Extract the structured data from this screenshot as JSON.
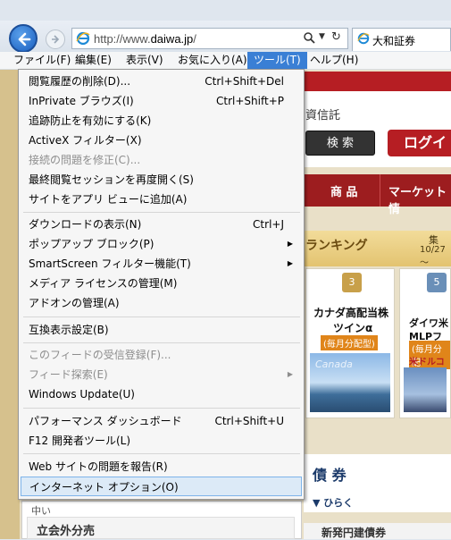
{
  "browser": {
    "address": {
      "prefix": "http://www.",
      "domain": "daiwa.jp",
      "suffix": "/"
    },
    "tab_title": "大和証券"
  },
  "menubar": [
    {
      "label": "ファイル(F)"
    },
    {
      "label": "編集(E)"
    },
    {
      "label": "表示(V)"
    },
    {
      "label": "お気に入り(A)"
    },
    {
      "label": "ツール(T)",
      "active": true
    },
    {
      "label": "ヘルプ(H)"
    }
  ],
  "tools_menu": [
    {
      "label": "閲覧履歴の削除(D)...",
      "shortcut": "Ctrl+Shift+Del"
    },
    {
      "label": "InPrivate ブラウズ(I)",
      "shortcut": "Ctrl+Shift+P"
    },
    {
      "label": "追跡防止を有効にする(K)"
    },
    {
      "label": "ActiveX フィルター(X)"
    },
    {
      "label": "接続の問題を修正(C)...",
      "disabled": true
    },
    {
      "label": "最終閲覧セッションを再度開く(S)"
    },
    {
      "label": "サイトをアプリ ビューに追加(A)"
    },
    {
      "label": "ダウンロードの表示(N)",
      "shortcut": "Ctrl+J"
    },
    {
      "label": "ポップアップ ブロック(P)",
      "submenu": true
    },
    {
      "label": "SmartScreen フィルター機能(T)",
      "submenu": true
    },
    {
      "label": "メディア ライセンスの管理(M)"
    },
    {
      "label": "アドオンの管理(A)"
    },
    {
      "label": "互換表示設定(B)"
    },
    {
      "label": "このフィードの受信登録(F)...",
      "disabled": true
    },
    {
      "label": "フィード探索(E)",
      "disabled": true,
      "submenu": true
    },
    {
      "label": "Windows Update(U)"
    },
    {
      "label": "パフォーマンス ダッシュボード",
      "shortcut": "Ctrl+Shift+U"
    },
    {
      "label": "F12 開発者ツール(L)"
    },
    {
      "label": "Web サイトの問題を報告(R)"
    },
    {
      "label": "インターネット オプション(O)",
      "highlighted": true
    }
  ],
  "page": {
    "shintaku": "資信託",
    "search_button": "検 索",
    "login_button": "ログイ",
    "nav1": "商 品",
    "nav2": "マーケット情",
    "ranking_title": "ランキング",
    "ranking_date1": "集",
    "ranking_date2": "10/27～",
    "card1": {
      "rank": "3",
      "line1": "カナダ高配当株",
      "line2": "ツインα",
      "badge": "(毎月分配型)",
      "image_text": "Canada"
    },
    "card2": {
      "rank": "5",
      "line1": "ダイワ米",
      "line2": "MLPファン",
      "badge": "(毎月分配",
      "line4": "米ドルコー"
    },
    "bond_title": "債 券",
    "bond_link": "▼ ひらく",
    "bond_item": "新発円建債券",
    "left_small": "中い",
    "left_title": "立会外分売"
  }
}
